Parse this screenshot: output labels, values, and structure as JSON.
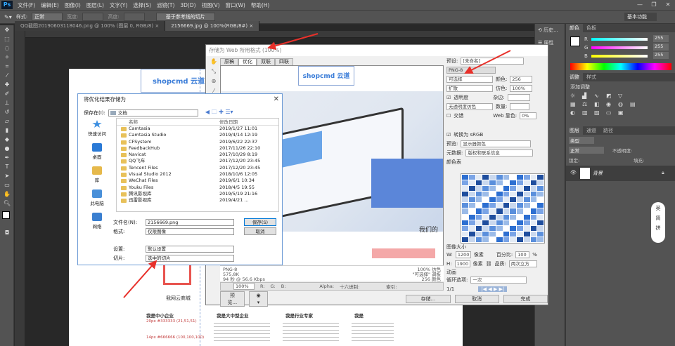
{
  "app": {
    "logo": "Ps",
    "menu": [
      "文件(F)",
      "编辑(E)",
      "图像(I)",
      "图层(L)",
      "文字(Y)",
      "选择(S)",
      "滤镜(T)",
      "3D(D)",
      "视图(V)",
      "窗口(W)",
      "帮助(H)"
    ],
    "workspace": "基本功能",
    "window_controls": [
      "—",
      "❐",
      "✕"
    ]
  },
  "options_bar": {
    "style_label": "样式:",
    "style_value": "正常",
    "width_label": "宽度:",
    "height_label": "高度:",
    "slice_button": "基于参考线的切片"
  },
  "doc_tabs": [
    "QQ截图20190603118046.png @ 100% (图层 0, RGB/8) ×",
    "2156669.jpg @ 100%(RGB/8#) ×"
  ],
  "right_icons": [
    {
      "icon": "history-icon",
      "label": "历史..."
    },
    {
      "icon": "properties-icon",
      "label": "属性"
    }
  ],
  "panels": {
    "color_tabs": [
      "颜色",
      "色板"
    ],
    "rgb": [
      {
        "ch": "R",
        "val": "255"
      },
      {
        "ch": "G",
        "val": "255"
      },
      {
        "ch": "B",
        "val": "255"
      }
    ],
    "adjust_tabs": [
      "调整",
      "样式"
    ],
    "adjust_title": "添加调整",
    "layers_tabs": [
      "图层",
      "通道",
      "路径"
    ],
    "layer_kind": "类型",
    "blend": "正常",
    "opacity_label": "不透明度:",
    "lock_label": "锁定:",
    "fill_label": "填充:",
    "layer_name": "背景"
  },
  "sfw": {
    "title": "存储为 Web 所用格式 (100%)",
    "tabs": [
      "原稿",
      "优化",
      "双联",
      "四联"
    ],
    "preset_label": "预设:",
    "preset_value": "[未命名]",
    "format_value": "PNG-8",
    "reduction": "可选择",
    "dither_alg": "扩散",
    "colors_label": "颜色:",
    "colors_value": "256",
    "dither_label": "仿色:",
    "dither_value": "100%",
    "transparency_label": "透明度",
    "matte_label": "杂边:",
    "no_transp_dither": "无透明度仿色",
    "amount_label": "数量:",
    "interlaced_label": "交错",
    "websnap_label": "Web 靠色:",
    "websnap_value": "0%",
    "convert_srgb": "转换为 sRGB",
    "preview_label": "预览:",
    "preview_value": "显示器颜色",
    "metadata_label": "元数据:",
    "metadata_value": "版权和联系信息",
    "color_table_label": "颜色表",
    "image_size_label": "图像大小",
    "w_label": "W:",
    "w_value": "1200",
    "h_label": "H:",
    "h_value": "1900",
    "px": "像素",
    "percent_label": "百分比:",
    "percent_value": "100",
    "percent_sign": "%",
    "quality_label": "品质:",
    "quality_value": "两次立方",
    "anim_label": "动画",
    "loop_label": "循环选项:",
    "loop_value": "一次",
    "frame_counter": "1/1",
    "status": [
      "PNG-8",
      "575.8K",
      "94 秒 @ 56.6 Kbps"
    ],
    "status_right": [
      "100% 仿色",
      "\"可选择\" 调板",
      "256 颜色"
    ],
    "zoom": "100%",
    "rgb_readout": [
      "R:",
      "G:",
      "B:",
      "Alpha:",
      "十六进制:",
      "索引:"
    ],
    "btn_preview": "预览...",
    "btn_save": "存储...",
    "btn_cancel": "取消",
    "btn_done": "完成",
    "preview_text": "我们的"
  },
  "save_dialog": {
    "title": "将优化结果存储为",
    "save_in_label": "保存在(I):",
    "save_in_value": "文档",
    "sidebar": [
      {
        "icon": "quick-access-icon",
        "label": "快速访问"
      },
      {
        "icon": "desktop-icon",
        "label": "桌面"
      },
      {
        "icon": "library-icon",
        "label": "库"
      },
      {
        "icon": "this-pc-icon",
        "label": "此电脑"
      },
      {
        "icon": "network-icon",
        "label": "网络"
      }
    ],
    "columns": [
      "名称",
      "修改日期"
    ],
    "files": [
      {
        "name": "Camtasia",
        "date": "2019/1/27 11:01"
      },
      {
        "name": "Camtasia Studio",
        "date": "2019/4/14 12:19"
      },
      {
        "name": "CFSystem",
        "date": "2019/6/22 22:37"
      },
      {
        "name": "FeedbackHub",
        "date": "2017/11/26 22:10"
      },
      {
        "name": "Navicat",
        "date": "2017/10/29 8:19"
      },
      {
        "name": "QQ飞车",
        "date": "2017/12/20 23:45"
      },
      {
        "name": "Tencent Files",
        "date": "2017/12/20 23:45"
      },
      {
        "name": "Visual Studio 2012",
        "date": "2018/10/6 12:05"
      },
      {
        "name": "WeChat Files",
        "date": "2019/6/1 10:34"
      },
      {
        "name": "Youku Files",
        "date": "2018/4/5 19:55"
      },
      {
        "name": "腾讯影视库",
        "date": "2019/5/19 21:16"
      },
      {
        "name": "迅雷影视库",
        "date": "2019/4/21 ..."
      }
    ],
    "filename_label": "文件名(N):",
    "filename_value": "2156669.png",
    "format_label": "格式:",
    "format_value": "仅限图像",
    "settings_label": "设置:",
    "settings_value": "默认设置",
    "slices_label": "切片:",
    "slices_value": "选中的切片",
    "save_btn": "保存(S)",
    "cancel_btn": "取消"
  },
  "canvas_page": {
    "brand": "shopcmd 云道",
    "mall_text": "我网云商城",
    "cols": [
      {
        "title": "我是中小企业",
        "body": "20px #333333 (21,51,51)"
      },
      {
        "title": "我是大中型企业",
        "body": ""
      },
      {
        "title": "我是行业专家",
        "body": ""
      },
      {
        "title": "我是创新门店",
        "body": ""
      }
    ],
    "note1": "14px #666666 (100,100,100)"
  },
  "floating": [
    "英",
    "简",
    "拼"
  ]
}
